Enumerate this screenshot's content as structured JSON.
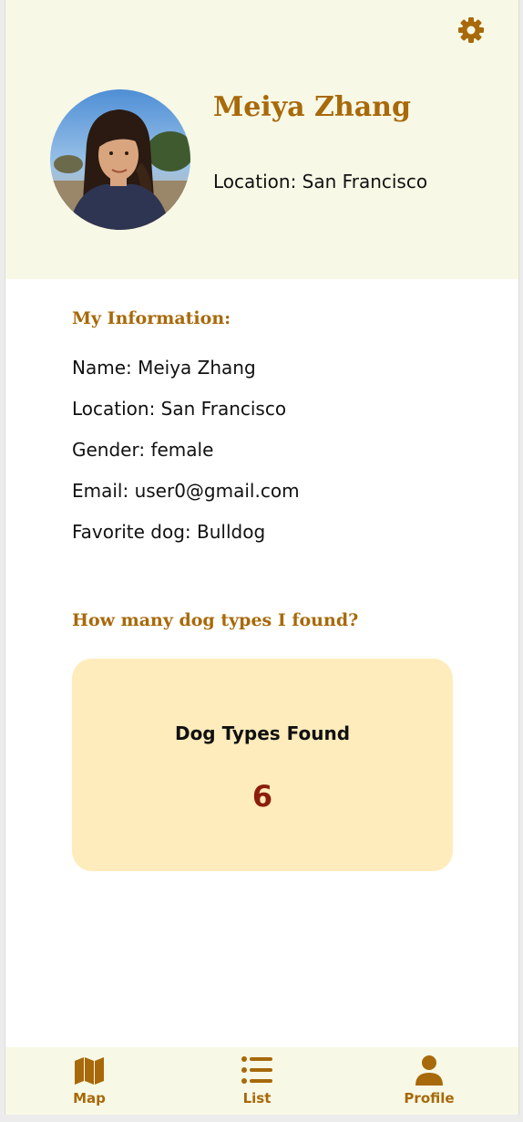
{
  "header": {
    "name": "Meiya Zhang",
    "location_line": "Location: San Francisco",
    "settings_icon": "gear-icon"
  },
  "info": {
    "title": "My Information:",
    "lines": [
      "Name: Meiya Zhang",
      "Location: San Francisco",
      "Gender: female",
      "Email: user0@gmail.com",
      "Favorite dog: Bulldog"
    ]
  },
  "dog_types": {
    "title": "How many dog types I found?",
    "card_title": "Dog Types Found",
    "count": "6"
  },
  "nav": {
    "items": [
      {
        "label": "Map",
        "icon": "map-icon"
      },
      {
        "label": "List",
        "icon": "list-icon"
      },
      {
        "label": "Profile",
        "icon": "user-icon"
      }
    ]
  },
  "colors": {
    "accent": "#a8690a",
    "header_bg": "#f8f8e6",
    "card_bg": "#ffecbc",
    "count_color": "#8b1e0a"
  }
}
